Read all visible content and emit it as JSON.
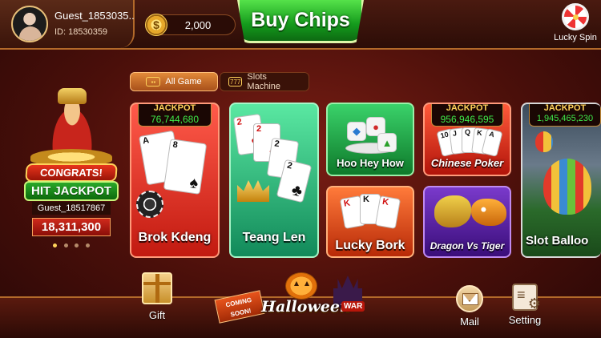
{
  "header": {
    "username": "Guest_1853035..",
    "user_id": "ID: 18530359",
    "chips": "2,000",
    "buy_chips_label": "Buy Chips",
    "lucky_spin_label": "Lucky Spin"
  },
  "jackpot_banner": {
    "congrats": "CONGRATS!",
    "hit_jackpot": "HIT JACKPOT",
    "winner": "Guest_18517867",
    "amount": "18,311,300",
    "page_count": 4,
    "active_page": 1
  },
  "tabs": [
    {
      "label": "All Game",
      "active": true,
      "icon": "gamepad-icon"
    },
    {
      "label": "Slots Machine",
      "active": false,
      "icon": "slot-machine-icon"
    }
  ],
  "games": {
    "brok_kdeng": {
      "label": "Brok Kdeng",
      "jackpot_word": "JACKPOT",
      "jackpot": "76,744,680"
    },
    "teang_len": {
      "label": "Teang Len"
    },
    "hoo_hey_how": {
      "label": "Hoo Hey How"
    },
    "lucky_bork": {
      "label": "Lucky Bork"
    },
    "chinese_poker": {
      "label": "Chinese Poker",
      "jackpot_word": "JACKPOT",
      "jackpot": "956,946,595"
    },
    "dragon_vs_tiger": {
      "label": "Dragon Vs Tiger"
    },
    "slot_balloon": {
      "label": "Slot Balloo",
      "jackpot_word": "JACKPOT",
      "jackpot": "1,945,465,230"
    }
  },
  "card_faces": {
    "brok": [
      "A",
      "8"
    ],
    "teang": [
      "2",
      "2",
      "2",
      "2"
    ],
    "lucky": [
      "K",
      "K",
      "K"
    ],
    "chinese": [
      "10",
      "J",
      "Q",
      "K",
      "A"
    ]
  },
  "promo": {
    "coming": "COMING",
    "soon": "SOON!",
    "title": "Halloween",
    "war": "WAR"
  },
  "footer": {
    "gift_label": "Gift",
    "mail_label": "Mail",
    "setting_label": "Setting"
  }
}
